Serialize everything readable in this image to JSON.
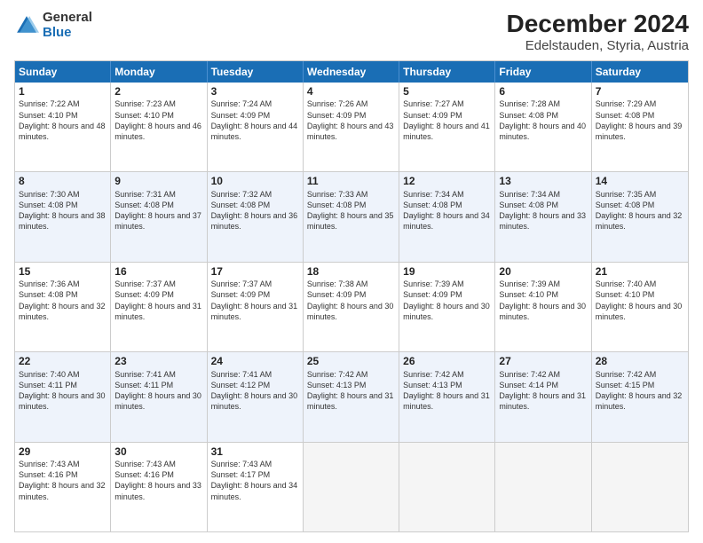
{
  "logo": {
    "general": "General",
    "blue": "Blue"
  },
  "title": "December 2024",
  "subtitle": "Edelstauden, Styria, Austria",
  "headers": [
    "Sunday",
    "Monday",
    "Tuesday",
    "Wednesday",
    "Thursday",
    "Friday",
    "Saturday"
  ],
  "weeks": [
    [
      {
        "day": "1",
        "sunrise": "Sunrise: 7:22 AM",
        "sunset": "Sunset: 4:10 PM",
        "daylight": "Daylight: 8 hours and 48 minutes."
      },
      {
        "day": "2",
        "sunrise": "Sunrise: 7:23 AM",
        "sunset": "Sunset: 4:10 PM",
        "daylight": "Daylight: 8 hours and 46 minutes."
      },
      {
        "day": "3",
        "sunrise": "Sunrise: 7:24 AM",
        "sunset": "Sunset: 4:09 PM",
        "daylight": "Daylight: 8 hours and 44 minutes."
      },
      {
        "day": "4",
        "sunrise": "Sunrise: 7:26 AM",
        "sunset": "Sunset: 4:09 PM",
        "daylight": "Daylight: 8 hours and 43 minutes."
      },
      {
        "day": "5",
        "sunrise": "Sunrise: 7:27 AM",
        "sunset": "Sunset: 4:09 PM",
        "daylight": "Daylight: 8 hours and 41 minutes."
      },
      {
        "day": "6",
        "sunrise": "Sunrise: 7:28 AM",
        "sunset": "Sunset: 4:08 PM",
        "daylight": "Daylight: 8 hours and 40 minutes."
      },
      {
        "day": "7",
        "sunrise": "Sunrise: 7:29 AM",
        "sunset": "Sunset: 4:08 PM",
        "daylight": "Daylight: 8 hours and 39 minutes."
      }
    ],
    [
      {
        "day": "8",
        "sunrise": "Sunrise: 7:30 AM",
        "sunset": "Sunset: 4:08 PM",
        "daylight": "Daylight: 8 hours and 38 minutes."
      },
      {
        "day": "9",
        "sunrise": "Sunrise: 7:31 AM",
        "sunset": "Sunset: 4:08 PM",
        "daylight": "Daylight: 8 hours and 37 minutes."
      },
      {
        "day": "10",
        "sunrise": "Sunrise: 7:32 AM",
        "sunset": "Sunset: 4:08 PM",
        "daylight": "Daylight: 8 hours and 36 minutes."
      },
      {
        "day": "11",
        "sunrise": "Sunrise: 7:33 AM",
        "sunset": "Sunset: 4:08 PM",
        "daylight": "Daylight: 8 hours and 35 minutes."
      },
      {
        "day": "12",
        "sunrise": "Sunrise: 7:34 AM",
        "sunset": "Sunset: 4:08 PM",
        "daylight": "Daylight: 8 hours and 34 minutes."
      },
      {
        "day": "13",
        "sunrise": "Sunrise: 7:34 AM",
        "sunset": "Sunset: 4:08 PM",
        "daylight": "Daylight: 8 hours and 33 minutes."
      },
      {
        "day": "14",
        "sunrise": "Sunrise: 7:35 AM",
        "sunset": "Sunset: 4:08 PM",
        "daylight": "Daylight: 8 hours and 32 minutes."
      }
    ],
    [
      {
        "day": "15",
        "sunrise": "Sunrise: 7:36 AM",
        "sunset": "Sunset: 4:08 PM",
        "daylight": "Daylight: 8 hours and 32 minutes."
      },
      {
        "day": "16",
        "sunrise": "Sunrise: 7:37 AM",
        "sunset": "Sunset: 4:09 PM",
        "daylight": "Daylight: 8 hours and 31 minutes."
      },
      {
        "day": "17",
        "sunrise": "Sunrise: 7:37 AM",
        "sunset": "Sunset: 4:09 PM",
        "daylight": "Daylight: 8 hours and 31 minutes."
      },
      {
        "day": "18",
        "sunrise": "Sunrise: 7:38 AM",
        "sunset": "Sunset: 4:09 PM",
        "daylight": "Daylight: 8 hours and 30 minutes."
      },
      {
        "day": "19",
        "sunrise": "Sunrise: 7:39 AM",
        "sunset": "Sunset: 4:09 PM",
        "daylight": "Daylight: 8 hours and 30 minutes."
      },
      {
        "day": "20",
        "sunrise": "Sunrise: 7:39 AM",
        "sunset": "Sunset: 4:10 PM",
        "daylight": "Daylight: 8 hours and 30 minutes."
      },
      {
        "day": "21",
        "sunrise": "Sunrise: 7:40 AM",
        "sunset": "Sunset: 4:10 PM",
        "daylight": "Daylight: 8 hours and 30 minutes."
      }
    ],
    [
      {
        "day": "22",
        "sunrise": "Sunrise: 7:40 AM",
        "sunset": "Sunset: 4:11 PM",
        "daylight": "Daylight: 8 hours and 30 minutes."
      },
      {
        "day": "23",
        "sunrise": "Sunrise: 7:41 AM",
        "sunset": "Sunset: 4:11 PM",
        "daylight": "Daylight: 8 hours and 30 minutes."
      },
      {
        "day": "24",
        "sunrise": "Sunrise: 7:41 AM",
        "sunset": "Sunset: 4:12 PM",
        "daylight": "Daylight: 8 hours and 30 minutes."
      },
      {
        "day": "25",
        "sunrise": "Sunrise: 7:42 AM",
        "sunset": "Sunset: 4:13 PM",
        "daylight": "Daylight: 8 hours and 31 minutes."
      },
      {
        "day": "26",
        "sunrise": "Sunrise: 7:42 AM",
        "sunset": "Sunset: 4:13 PM",
        "daylight": "Daylight: 8 hours and 31 minutes."
      },
      {
        "day": "27",
        "sunrise": "Sunrise: 7:42 AM",
        "sunset": "Sunset: 4:14 PM",
        "daylight": "Daylight: 8 hours and 31 minutes."
      },
      {
        "day": "28",
        "sunrise": "Sunrise: 7:42 AM",
        "sunset": "Sunset: 4:15 PM",
        "daylight": "Daylight: 8 hours and 32 minutes."
      }
    ],
    [
      {
        "day": "29",
        "sunrise": "Sunrise: 7:43 AM",
        "sunset": "Sunset: 4:16 PM",
        "daylight": "Daylight: 8 hours and 32 minutes."
      },
      {
        "day": "30",
        "sunrise": "Sunrise: 7:43 AM",
        "sunset": "Sunset: 4:16 PM",
        "daylight": "Daylight: 8 hours and 33 minutes."
      },
      {
        "day": "31",
        "sunrise": "Sunrise: 7:43 AM",
        "sunset": "Sunset: 4:17 PM",
        "daylight": "Daylight: 8 hours and 34 minutes."
      },
      null,
      null,
      null,
      null
    ]
  ]
}
